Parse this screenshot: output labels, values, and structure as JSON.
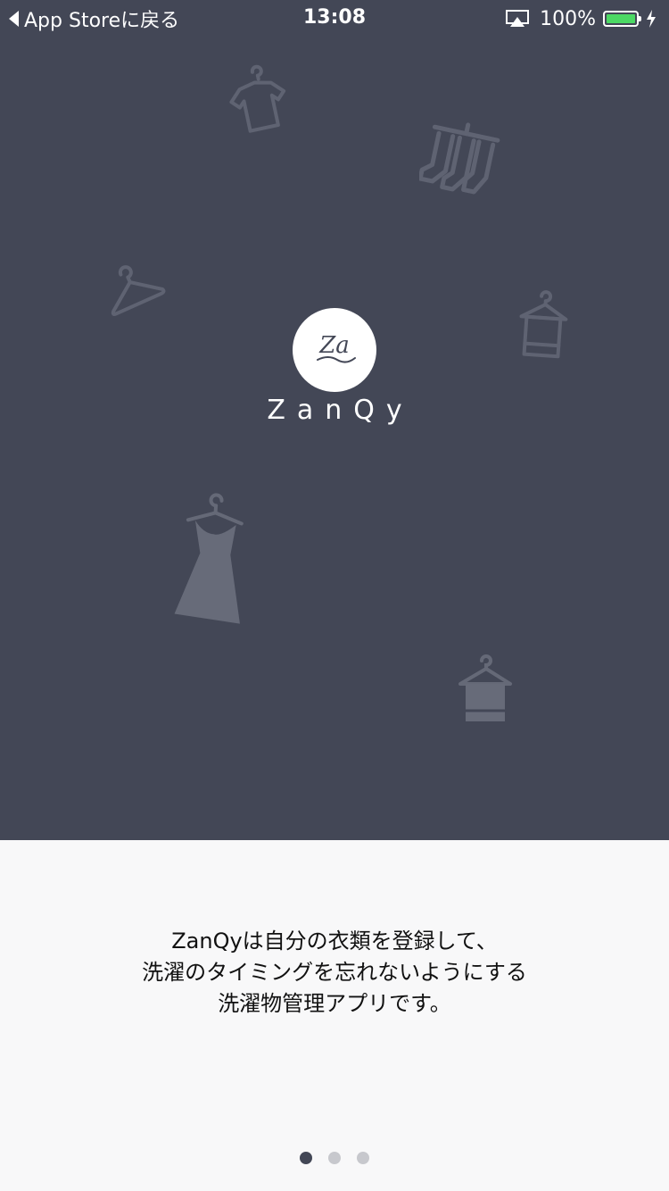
{
  "status_bar": {
    "back_label": "App Storeに戻る",
    "time": "13:08",
    "battery_percent": "100%",
    "battery_level": 1.0,
    "battery_color": "#4cd964"
  },
  "hero": {
    "background_color": "#434756",
    "logo_mark": "Za",
    "app_name": "ZanQy",
    "decorative_icons": [
      "tshirt-icon",
      "socks-hanger-icon",
      "hanger-icon",
      "towel-hanger-icon",
      "dress-icon",
      "towel-hanger-icon"
    ]
  },
  "description": {
    "line1": "ZanQyは自分の衣類を登録して、",
    "line2": "洗濯のタイミングを忘れないようにする",
    "line3": "洗濯物管理アプリです。"
  },
  "pagination": {
    "count": 3,
    "active_index": 0
  }
}
